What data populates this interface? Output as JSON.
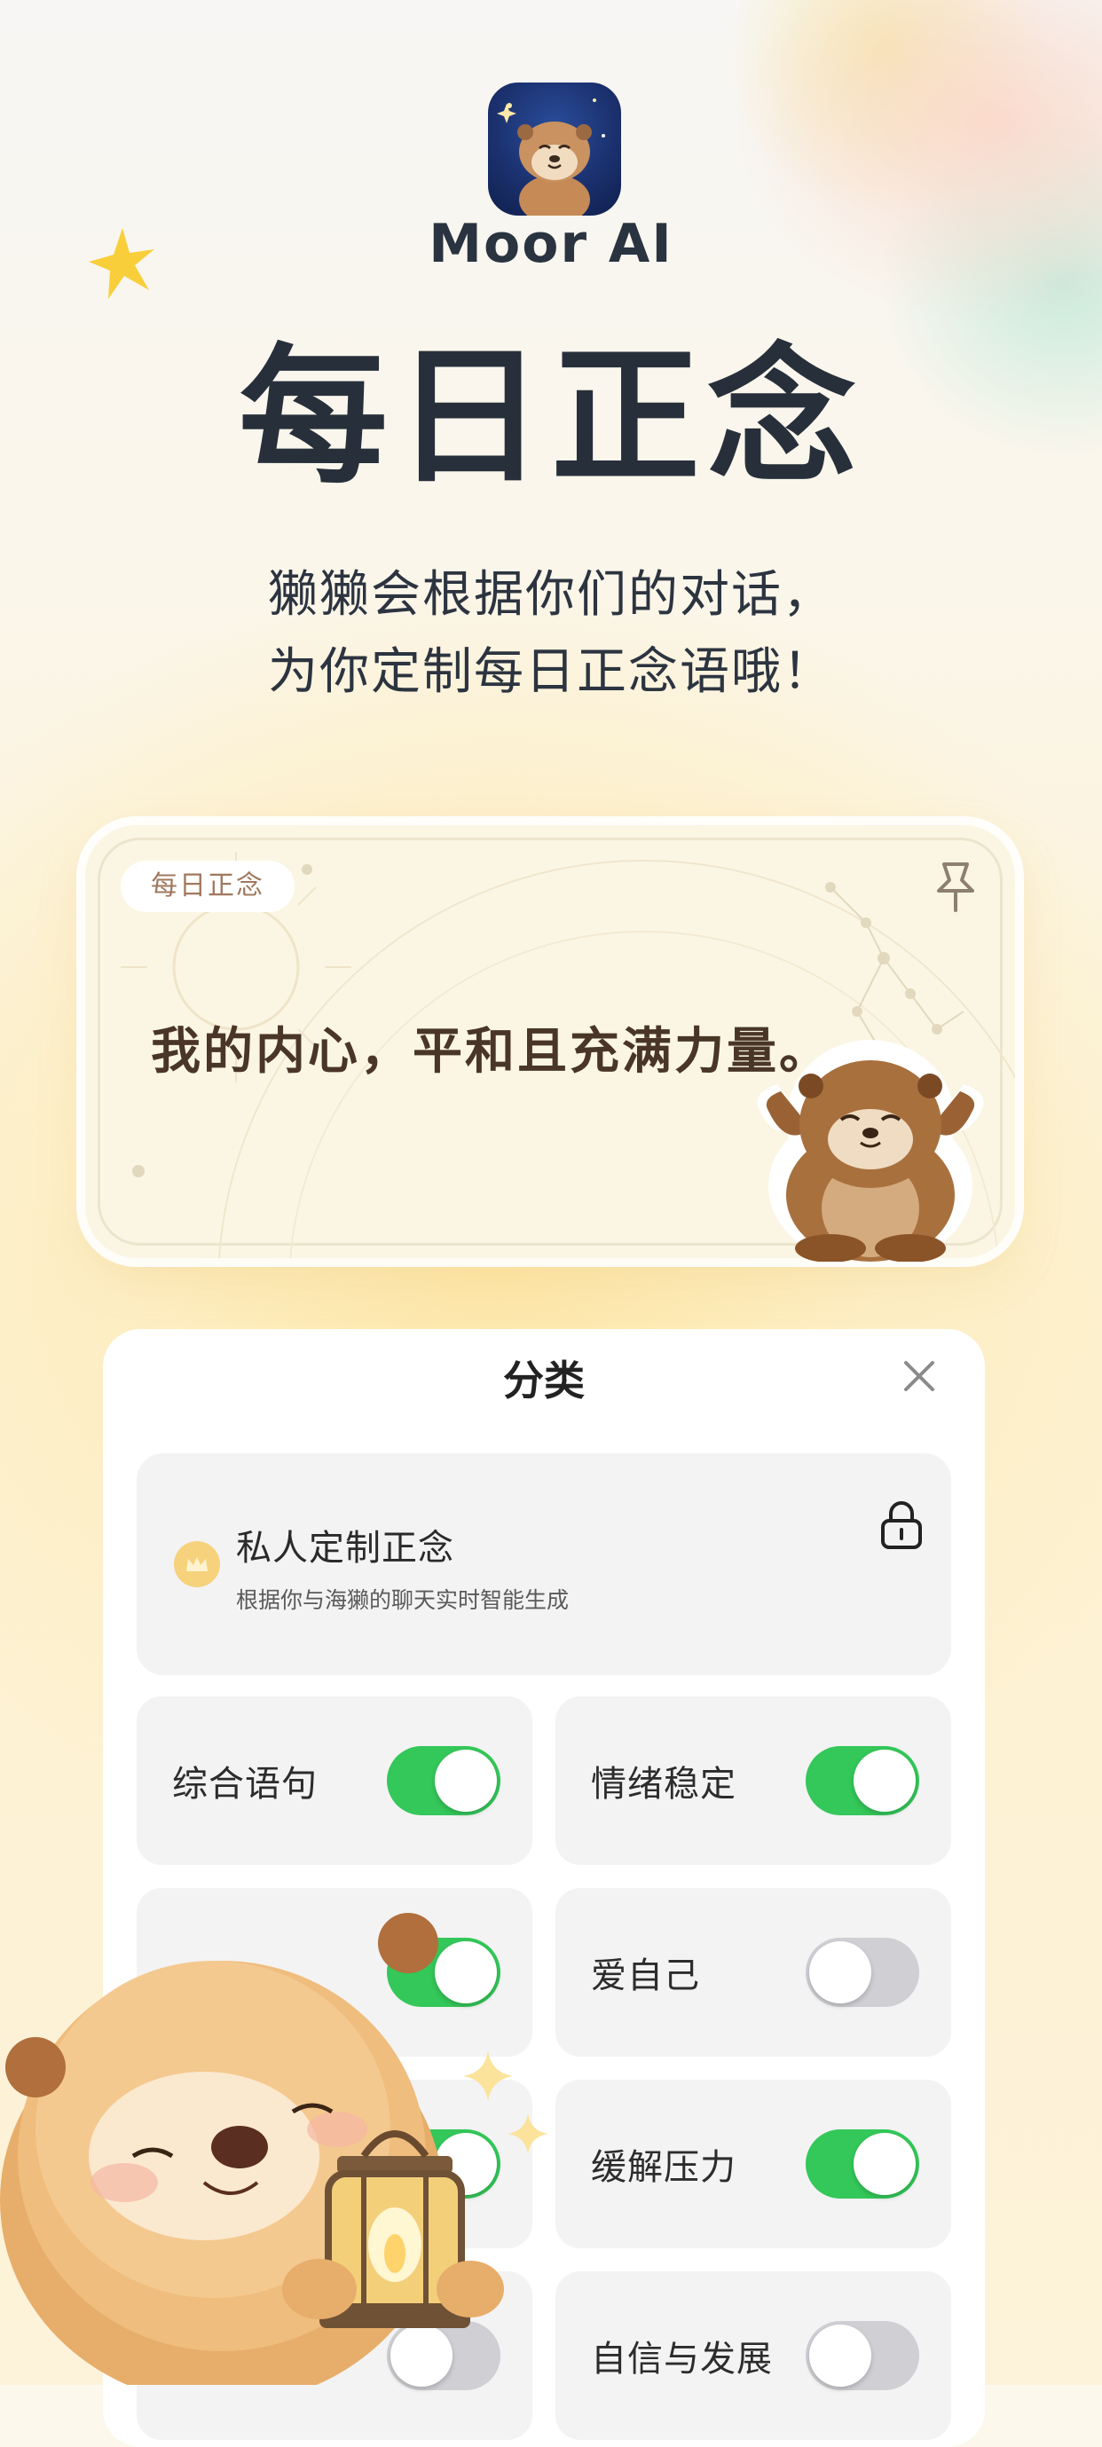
{
  "app": {
    "name": "Moor AI",
    "icon": "otter-app-icon"
  },
  "hero": {
    "title": "每日正念",
    "subtitle_line1": "獭獭会根据你们的对话，",
    "subtitle_line2": "为你定制每日正念语哦！"
  },
  "quote_card": {
    "tag": "每日正念",
    "text": "我的内心，平和且充满力量。",
    "pin_icon": "pin-icon"
  },
  "category_panel": {
    "title": "分类",
    "close_icon": "close-icon",
    "private": {
      "title": "私人定制正念",
      "description": "根据你与海獭的聊天实时智能生成",
      "locked": true,
      "icons": [
        "crown-icon",
        "lock-icon"
      ]
    },
    "categories": [
      {
        "label": "综合语句",
        "on": true
      },
      {
        "label": "情绪稳定",
        "on": true
      },
      {
        "label": "",
        "on": true
      },
      {
        "label": "爱自己",
        "on": false
      },
      {
        "label": "",
        "on": true
      },
      {
        "label": "缓解压力",
        "on": true
      },
      {
        "label": "",
        "on": false
      },
      {
        "label": "自信与发展",
        "on": false
      }
    ]
  },
  "colors": {
    "toggle_on": "#34c759",
    "toggle_off": "#cfcfd4",
    "title_text": "#27303a",
    "quote_text": "#4a3626"
  }
}
